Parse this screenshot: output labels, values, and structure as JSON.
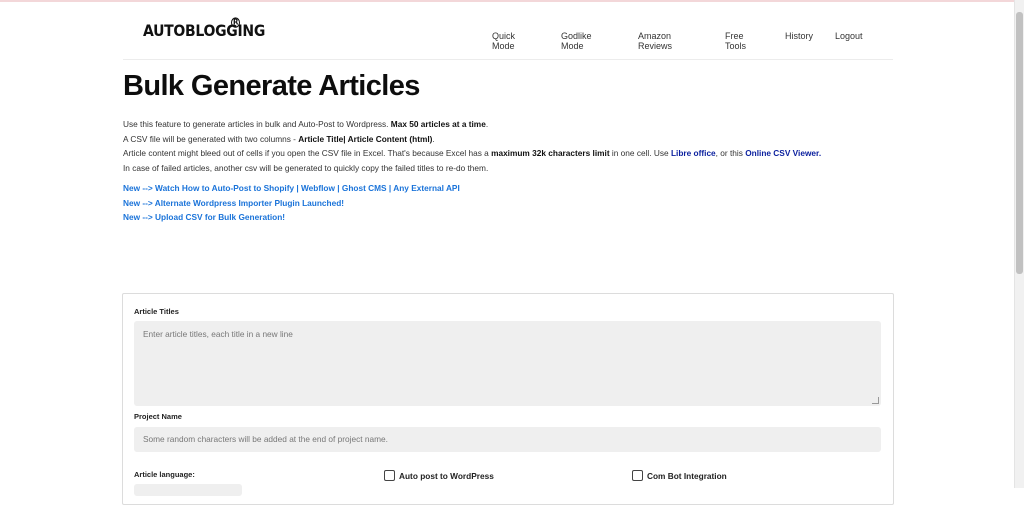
{
  "brand": {
    "logo": "AUTOBLOGGING",
    "reg_mark": "R"
  },
  "nav": {
    "quick_mode": "Quick Mode",
    "godlike_mode": "Godlike Mode",
    "amazon_reviews": "Amazon Reviews",
    "free_tools": "Free Tools",
    "history": "History",
    "logout": "Logout"
  },
  "page": {
    "title": "Bulk Generate Articles",
    "desc": {
      "l1_a": "Use this feature to generate articles in bulk and Auto-Post to Wordpress. ",
      "l1_b": "Max 50 articles at a time",
      "l1_c": ".",
      "l2_a": "A CSV file will be generated with two columns - ",
      "l2_b": "Article Title| Article Content (html)",
      "l2_c": ".",
      "l3_a": "Article content might bleed out of cells if you open the CSV file in Excel. That's because Excel has a ",
      "l3_b": "maximum 32k characters limit",
      "l3_c": " in one cell. Use ",
      "l3_link1": "Libre office",
      "l3_d": ", or this ",
      "l3_link2": "Online CSV Viewer.",
      "l4": "In case of failed articles, another csv will be generated to quickly copy the failed titles to re-do them."
    },
    "links": {
      "link1": "New --> Watch How to Auto-Post to Shopify | Webflow | Ghost CMS | Any External API",
      "link2": "New --> Alternate Wordpress Importer Plugin Launched!",
      "link3": "New --> Upload CSV for Bulk Generation!"
    }
  },
  "form": {
    "titles_label": "Article Titles",
    "titles_placeholder": "Enter article titles, each title in a new line",
    "project_label": "Project Name",
    "project_placeholder": "Some random characters will be added at the end of project name.",
    "language_label": "Article language:",
    "autopost_label": "Auto post to WordPress",
    "combot_label": "Com Bot Integration"
  }
}
